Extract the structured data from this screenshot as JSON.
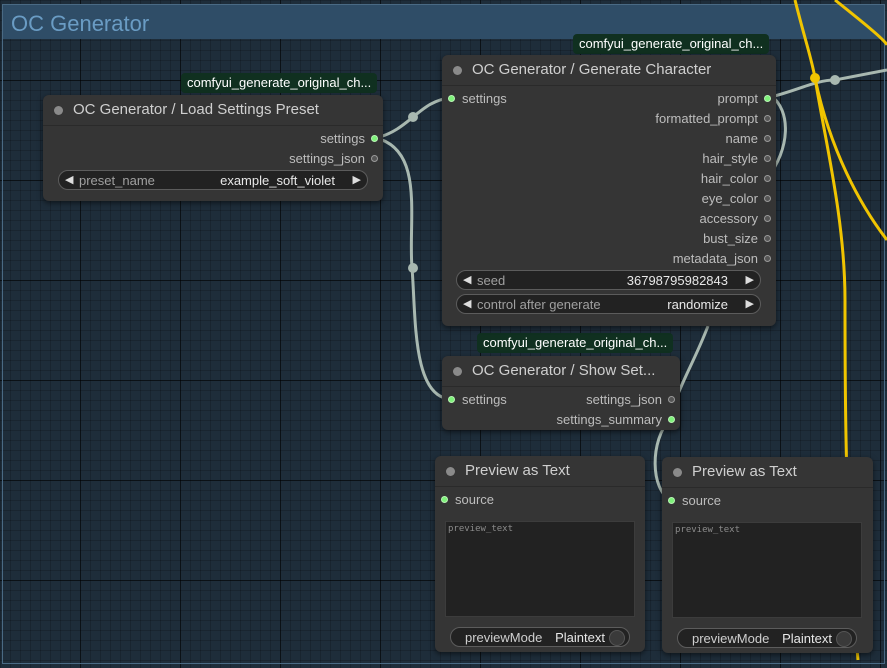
{
  "group": {
    "title": "OC Generator"
  },
  "badges": {
    "load": "comfyui_generate_original_ch...",
    "generate": "comfyui_generate_original_ch...",
    "show": "comfyui_generate_original_ch..."
  },
  "load_node": {
    "title": "OC Generator / Load Settings Preset",
    "outputs": [
      "settings",
      "settings_json"
    ],
    "widget": {
      "label": "preset_name",
      "value": "example_soft_violet"
    }
  },
  "generate_node": {
    "title": "OC Generator / Generate Character",
    "input": "settings",
    "outputs": [
      "prompt",
      "formatted_prompt",
      "name",
      "hair_style",
      "hair_color",
      "eye_color",
      "accessory",
      "bust_size",
      "metadata_json"
    ],
    "seed": {
      "label": "seed",
      "value": "36798795982843"
    },
    "control": {
      "label": "control after generate",
      "value": "randomize"
    }
  },
  "show_node": {
    "title": "OC Generator / Show Set...",
    "input": "settings",
    "outputs": [
      "settings_json",
      "settings_summary"
    ]
  },
  "preview_left": {
    "title": "Preview as Text",
    "input": "source",
    "text": "preview_text",
    "mode_label": "previewMode",
    "mode_value": "Plaintext"
  },
  "preview_right": {
    "title": "Preview as Text",
    "input": "source",
    "text": "preview_text",
    "mode_label": "previewMode",
    "mode_value": "Plaintext"
  },
  "colors": {
    "canvas": "#1e2d3a",
    "group_header": "#2f4d67",
    "node": "#353535",
    "wire": "#a8b8b0",
    "wire_yellow": "#f0c400",
    "port_connected": "#7ef27a",
    "badge": "#103020"
  }
}
